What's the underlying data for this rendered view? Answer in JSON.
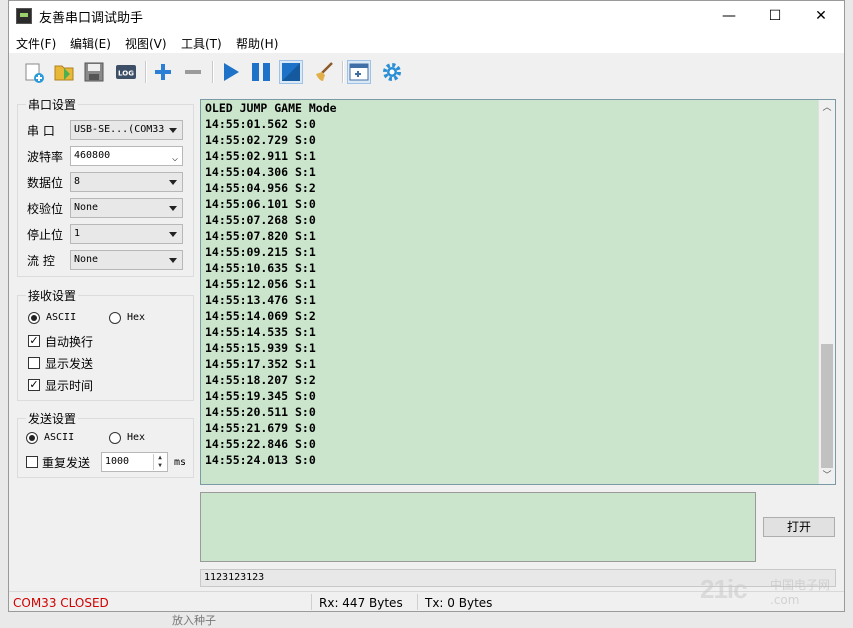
{
  "window": {
    "title": "友善串口调试助手",
    "minimize": "—",
    "maximize": "☐",
    "close": "✕"
  },
  "menu": [
    "文件(F)",
    "编辑(E)",
    "视图(V)",
    "工具(T)",
    "帮助(H)"
  ],
  "toolbar": {
    "icons": [
      "new-icon",
      "open-icon",
      "save-icon",
      "log-icon",
      "add-icon",
      "remove-icon",
      "play-icon",
      "pause-icon",
      "stop-icon",
      "clear-icon",
      "window-icon",
      "settings-icon"
    ],
    "log_label": "LOG",
    "accent": "#1e73c8"
  },
  "serial": {
    "title": "串口设置",
    "port_label": "串 口",
    "port_value": "USB-SE...(COM33",
    "baud_label": "波特率",
    "baud_value": "460800",
    "data_label": "数据位",
    "data_value": "8",
    "parity_label": "校验位",
    "parity_value": "None",
    "stop_label": "停止位",
    "stop_value": "1",
    "flow_label": "流 控",
    "flow_value": "None"
  },
  "receive": {
    "title": "接收设置",
    "ascii": "ASCII",
    "hex": "Hex",
    "selected": "ASCII",
    "auto_wrap": "自动换行",
    "auto_wrap_checked": true,
    "show_send": "显示发送",
    "show_send_checked": false,
    "show_time": "显示时间",
    "show_time_checked": true
  },
  "send": {
    "title": "发送设置",
    "ascii": "ASCII",
    "hex": "Hex",
    "selected": "ASCII",
    "repeat": "重复发送",
    "repeat_checked": false,
    "interval": "1000",
    "unit": "ms"
  },
  "rx_lines": [
    "OLED JUMP GAME Mode",
    "14:55:01.562 S:0",
    "14:55:02.729 S:0",
    "14:55:02.911 S:1",
    "14:55:04.306 S:1",
    "14:55:04.956 S:2",
    "14:55:06.101 S:0",
    "14:55:07.268 S:0",
    "14:55:07.820 S:1",
    "14:55:09.215 S:1",
    "14:55:10.635 S:1",
    "14:55:12.056 S:1",
    "14:55:13.476 S:1",
    "14:55:14.069 S:2",
    "14:55:14.535 S:1",
    "14:55:15.939 S:1",
    "14:55:17.352 S:1",
    "14:55:18.207 S:2",
    "14:55:19.345 S:0",
    "14:55:20.511 S:0",
    "14:55:21.679 S:0",
    "14:55:22.846 S:0",
    "14:55:24.013 S:0"
  ],
  "rx_bg": "#cbe5cd",
  "open_button": "打开",
  "history_value": "1123123123",
  "status": {
    "port": "COM33 CLOSED",
    "port_color": "#d00000",
    "rx": "Rx: 447 Bytes",
    "tx": "Tx: 0 Bytes"
  },
  "watermark": {
    "logo": "21ic",
    "sub": "中国电子网",
    "domain": ".com"
  },
  "behind_text": "放入种子"
}
